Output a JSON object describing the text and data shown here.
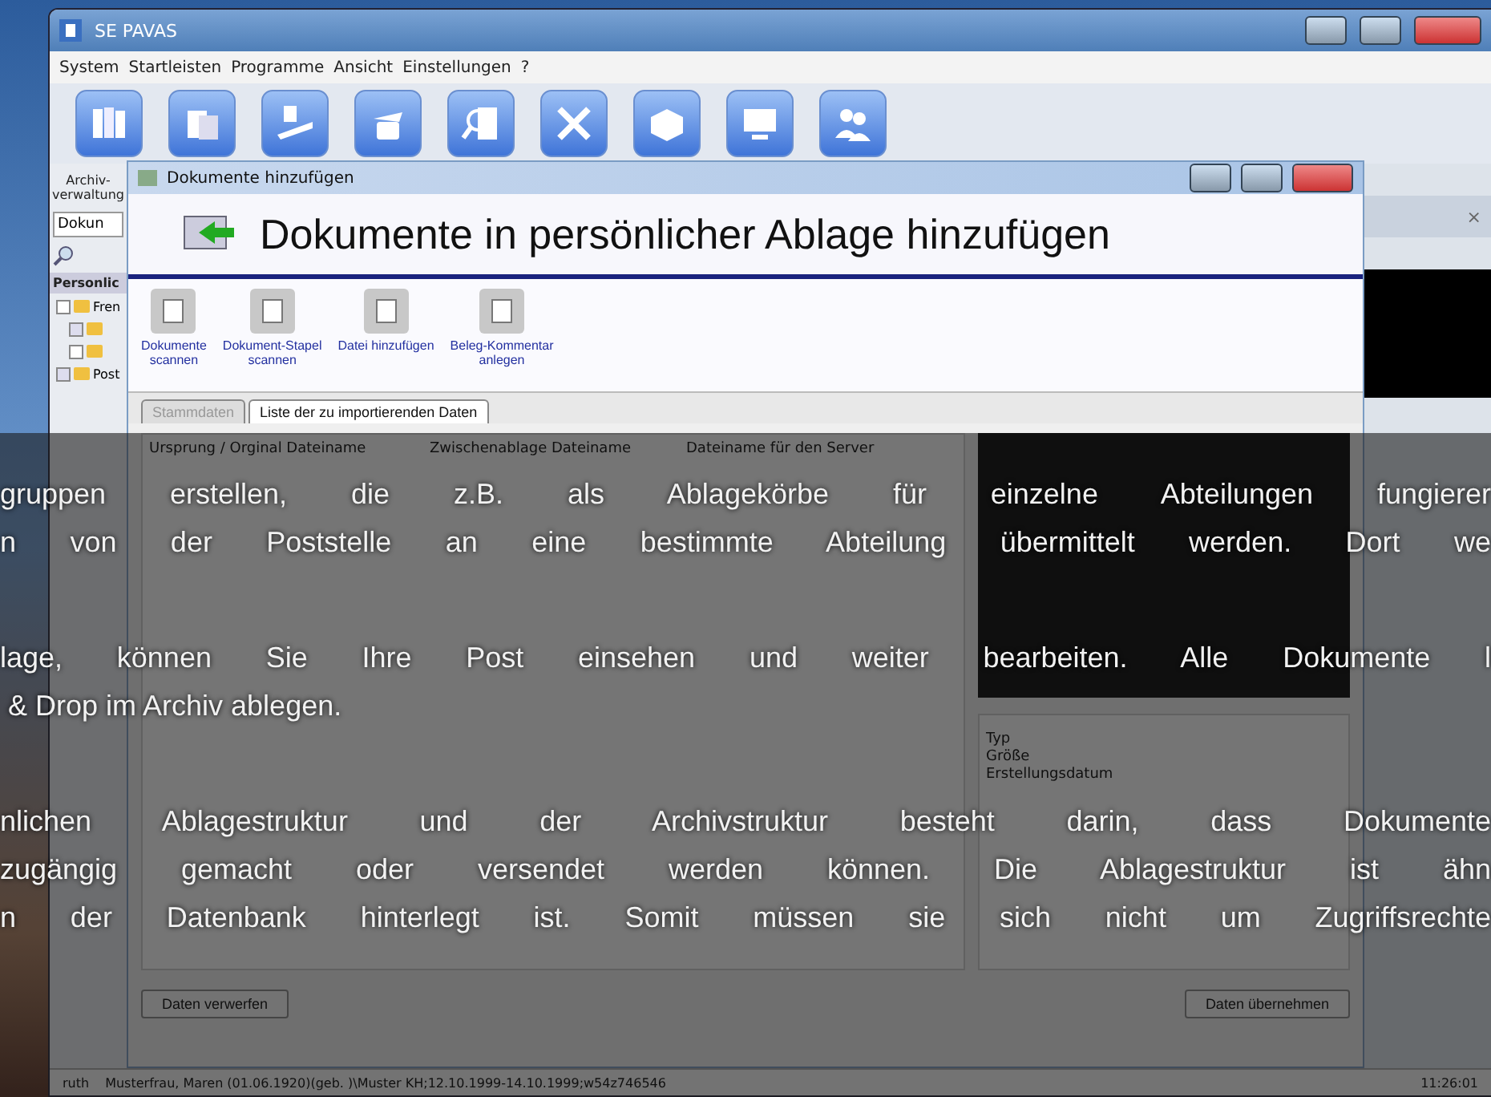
{
  "window": {
    "title": "SE PAVAS"
  },
  "menu": [
    "System",
    "Startleisten",
    "Programme",
    "Ansicht",
    "Einstellungen",
    "?"
  ],
  "side_label": "Archiv-\nverwaltung",
  "side_panel": {
    "tab": "Dokun",
    "heading": "Personlic",
    "tree": [
      {
        "label": "Fren",
        "expanded": true,
        "children": [
          {
            "expanded": false
          },
          {
            "expanded": true
          }
        ]
      },
      {
        "label": "Post",
        "expanded": false
      }
    ]
  },
  "dialog": {
    "title": "Dokumente hinzufügen",
    "heading": "Dokumente in persönlicher Ablage hinzufügen",
    "actions": [
      "Dokumente\nscannen",
      "Dokument-Stapel\nscannen",
      "Datei hinzufügen",
      "Beleg-Kommentar\nanlegen"
    ],
    "tabs": [
      {
        "label": "Stammdaten",
        "selected": false
      },
      {
        "label": "Liste der zu importierenden Daten",
        "selected": true
      }
    ],
    "table": {
      "columns": [
        "Ursprung / Orginal Dateiname",
        "Zwischenablage Dateiname",
        "Dateiname für den Server"
      ]
    },
    "properties": [
      "Typ",
      "Größe",
      "Erstellungsdatum"
    ],
    "buttons": [
      "Daten verwerfen",
      "Daten übernehmen"
    ]
  },
  "back_panel": {
    "close": "×"
  },
  "status_bar": [
    "ruth",
    "Musterfrau, Maren (01.06.1920)(geb. )\\Muster KH;12.10.1999-14.10.1999;w54z746546",
    "11:26:01"
  ],
  "overlay": {
    "paragraphs": [
      {
        "lines": [
          {
            "text": "gruppen erstellen, die z.B. als Ablagekörbe für einzelne Abteilungen fungierer",
            "justified": true
          },
          {
            "text": "n von der Poststelle an eine bestimmte Abteilung übermittelt werden. Dort we",
            "justified": true
          }
        ]
      },
      {
        "lines": [
          {
            "text": "lage, können Sie Ihre Post einsehen und weiter bearbeiten. Alle Dokumente l",
            "justified": true
          },
          {
            "text": " & Drop im Archiv ablegen.",
            "justified": false
          }
        ]
      },
      {
        "lines": [
          {
            "text": "nlichen Ablagestruktur und der Archivstruktur besteht darin, dass Dokumente",
            "justified": true
          },
          {
            "text": "zugängig gemacht oder versendet werden können. Die Ablagestruktur ist ähn",
            "justified": true
          },
          {
            "text": "n der Datenbank hinterlegt ist. Somit müssen sie sich nicht um Zugriffsrechte",
            "justified": true
          }
        ]
      }
    ]
  }
}
